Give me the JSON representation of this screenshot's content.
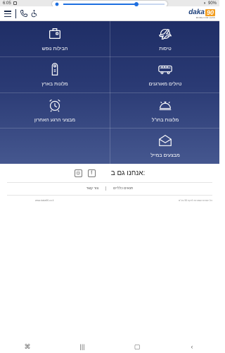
{
  "status_bar": {
    "time": "6:05",
    "battery": "90%",
    "volume_level": 0.72
  },
  "header": {
    "logo_word": "daka",
    "logo_number": "90",
    "logo_subtitle": "MORE FOR LESS"
  },
  "menu": {
    "tiles": [
      {
        "label": "טיסות",
        "icon": "airplane-icon"
      },
      {
        "label": "חבילות נופש",
        "icon": "suitcase-icon"
      },
      {
        "label": "טיולים מאורגנים",
        "icon": "bus-icon"
      },
      {
        "label": "מלונות בארץ",
        "icon": "door-hanger-icon"
      },
      {
        "label": "מלונות בחו\"ל",
        "icon": "service-bell-icon"
      },
      {
        "label": "מבצעי הרגע האחרון",
        "icon": "alarm-clock-icon"
      },
      {
        "label": "מבצעים במייל",
        "icon": "email-icon"
      }
    ]
  },
  "social": {
    "title": "אנחנו גם ב:",
    "facebook": "f",
    "instagram": "◎"
  },
  "links": {
    "terms": "תנאים כלליים",
    "contact": "צור קשר"
  },
  "footer": {
    "copyright": "כל הזכויות שמורות לדקה 90 בע\"מ",
    "site": "www.daka90.co.il"
  },
  "colors": {
    "grid_top": "#1f2e66",
    "grid_bottom": "#45578f",
    "logo_orange": "#f29d1f",
    "logo_blue": "#1c3f7a"
  }
}
